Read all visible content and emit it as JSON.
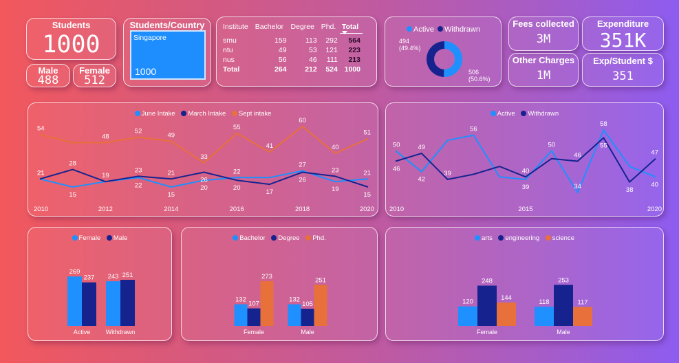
{
  "colors": {
    "blue": "#1e90ff",
    "navy": "#16238f",
    "orange": "#e8703a"
  },
  "kpi": {
    "students": {
      "title": "Students",
      "value": "1000"
    },
    "male": {
      "title": "Male",
      "value": "488"
    },
    "female": {
      "title": "Female",
      "value": "512"
    },
    "fees": {
      "title": "Fees collected",
      "value": "3M"
    },
    "other": {
      "title": "Other Charges",
      "value": "1M"
    },
    "expenditure": {
      "title": "Expenditure",
      "value": "351K"
    },
    "exp_student": {
      "title": "Exp/Student $",
      "value": "351"
    }
  },
  "country_slicer": {
    "title": "Students/Country",
    "selected": "Singapore",
    "count": "1000"
  },
  "institute_table": {
    "headers": [
      "Institute",
      "Bachelor",
      "Degree",
      "Phd.",
      "Total"
    ],
    "rows": [
      [
        "smu",
        "159",
        "113",
        "292",
        "564"
      ],
      [
        "ntu",
        "49",
        "53",
        "121",
        "223"
      ],
      [
        "nus",
        "56",
        "46",
        "111",
        "213"
      ]
    ],
    "total_row": [
      "Total",
      "264",
      "212",
      "524",
      "1000"
    ],
    "sort_icon": "sort-descending-icon"
  },
  "chart_data": [
    {
      "type": "pie",
      "subtype": "donut",
      "legend_position": "top",
      "legend": [
        "Active",
        "Withdrawn"
      ],
      "slices": [
        {
          "name": "Active",
          "value": 506,
          "pct": "50.6%"
        },
        {
          "name": "Withdrawn",
          "value": 494,
          "pct": "49.4%"
        }
      ],
      "labels": [
        {
          "value": "494",
          "pct": "(49.4%)"
        },
        {
          "value": "506",
          "pct": "(50.6%)"
        }
      ]
    },
    {
      "type": "line",
      "legend_position": "top",
      "x": [
        2010,
        2011,
        2012,
        2013,
        2014,
        2015,
        2016,
        2017,
        2018,
        2019,
        2020
      ],
      "x_ticks": [
        "2010",
        "2012",
        "2014",
        "2016",
        "2018",
        "2020"
      ],
      "grid": false,
      "series": [
        {
          "name": "June Intake",
          "color": "#1e90ff",
          "values": [
            21,
            15,
            19,
            22,
            15,
            20,
            22,
            22,
            27,
            19,
            21
          ]
        },
        {
          "name": "March Intake",
          "color": "#16238f",
          "values": [
            21,
            28,
            19,
            23,
            21,
            26,
            20,
            17,
            26,
            23,
            15
          ]
        },
        {
          "name": "Sept intake",
          "color": "#e8703a",
          "values": [
            54,
            48,
            48,
            52,
            49,
            33,
            55,
            41,
            60,
            40,
            51
          ]
        }
      ],
      "data_labels": [
        {
          "i": 0,
          "v": "54"
        },
        {
          "i": 0,
          "v": "21"
        },
        {
          "i": 0,
          "v": "21"
        },
        {
          "i": 1,
          "v": "28"
        },
        {
          "i": 1,
          "v": "15"
        },
        {
          "i": 2,
          "v": "48"
        },
        {
          "i": 2,
          "v": "19"
        },
        {
          "i": 3,
          "v": "52"
        },
        {
          "i": 3,
          "v": "23"
        },
        {
          "i": 3,
          "v": "22"
        },
        {
          "i": 4,
          "v": "49"
        },
        {
          "i": 4,
          "v": "21"
        },
        {
          "i": 4,
          "v": "15"
        },
        {
          "i": 5,
          "v": "33"
        },
        {
          "i": 5,
          "v": "26"
        },
        {
          "i": 5,
          "v": "20"
        },
        {
          "i": 6,
          "v": "55"
        },
        {
          "i": 6,
          "v": "22"
        },
        {
          "i": 6,
          "v": "20"
        },
        {
          "i": 7,
          "v": "41"
        },
        {
          "i": 7,
          "v": "17"
        },
        {
          "i": 8,
          "v": "60"
        },
        {
          "i": 8,
          "v": "27"
        },
        {
          "i": 8,
          "v": "26"
        },
        {
          "i": 9,
          "v": "40"
        },
        {
          "i": 9,
          "v": "23"
        },
        {
          "i": 9,
          "v": "19"
        },
        {
          "i": 10,
          "v": "51"
        },
        {
          "i": 10,
          "v": "21"
        },
        {
          "i": 10,
          "v": "15"
        }
      ]
    },
    {
      "type": "line",
      "legend_position": "top",
      "x": [
        2010,
        2011,
        2012,
        2013,
        2014,
        2015,
        2016,
        2017,
        2018,
        2019,
        2020
      ],
      "x_ticks": [
        "2010",
        "2015",
        "2020"
      ],
      "grid": false,
      "series": [
        {
          "name": "Active",
          "color": "#1e90ff",
          "values": [
            50,
            42,
            54,
            56,
            40,
            39,
            50,
            34,
            58,
            44,
            40
          ]
        },
        {
          "name": "Withdrawn",
          "color": "#16238f",
          "values": [
            46,
            49,
            39,
            41,
            44,
            40,
            47,
            46,
            55,
            38,
            47
          ]
        }
      ],
      "data_labels": [
        {
          "i": 0,
          "v": "50"
        },
        {
          "i": 0,
          "v": "46"
        },
        {
          "i": 1,
          "v": "49"
        },
        {
          "i": 1,
          "v": "42"
        },
        {
          "i": 2,
          "v": "39"
        },
        {
          "i": 3,
          "v": "56"
        },
        {
          "i": 5,
          "v": "39"
        },
        {
          "i": 5,
          "v": "40"
        },
        {
          "i": 6,
          "v": "50"
        },
        {
          "i": 7,
          "v": "46"
        },
        {
          "i": 7,
          "v": "34"
        },
        {
          "i": 8,
          "v": "55"
        },
        {
          "i": 8,
          "v": "58"
        },
        {
          "i": 9,
          "v": "38"
        },
        {
          "i": 10,
          "v": "47"
        },
        {
          "i": 10,
          "v": "40"
        }
      ]
    },
    {
      "type": "bar",
      "legend_position": "top",
      "categories": [
        "Active",
        "Withdrawn"
      ],
      "series": [
        {
          "name": "Female",
          "color": "#1e90ff",
          "values": [
            269,
            243
          ]
        },
        {
          "name": "Male",
          "color": "#16238f",
          "values": [
            237,
            251
          ]
        }
      ]
    },
    {
      "type": "bar",
      "legend_position": "top",
      "categories": [
        "Female",
        "Male"
      ],
      "series": [
        {
          "name": "Bachelor",
          "color": "#1e90ff",
          "values": [
            132,
            132
          ]
        },
        {
          "name": "Degree",
          "color": "#16238f",
          "values": [
            107,
            105
          ]
        },
        {
          "name": "Phd.",
          "color": "#e8703a",
          "values": [
            273,
            251
          ]
        }
      ]
    },
    {
      "type": "bar",
      "legend_position": "top",
      "categories": [
        "Female",
        "Male"
      ],
      "series": [
        {
          "name": "arts",
          "color": "#1e90ff",
          "values": [
            120,
            118
          ]
        },
        {
          "name": "engineering",
          "color": "#16238f",
          "values": [
            248,
            253
          ]
        },
        {
          "name": "science",
          "color": "#e8703a",
          "values": [
            144,
            117
          ]
        }
      ]
    }
  ]
}
